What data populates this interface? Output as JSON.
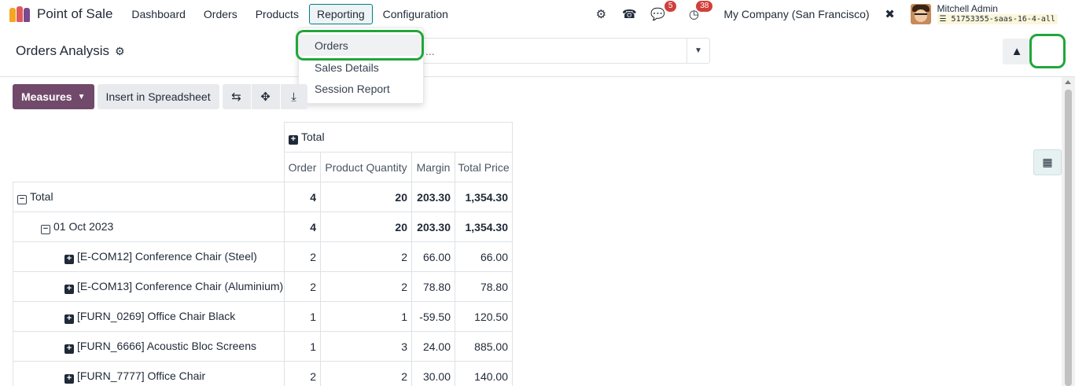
{
  "navbar": {
    "app_name": "Point of Sale",
    "menu": [
      "Dashboard",
      "Orders",
      "Products",
      "Reporting",
      "Configuration"
    ],
    "active_menu": "Reporting",
    "chat_badge": "5",
    "activity_badge": "38",
    "company": "My Company (San Francisco)",
    "user_name": "Mitchell Admin",
    "db_name": "51753355-saas-16-4-all"
  },
  "control_panel": {
    "title": "Orders Analysis",
    "search_text": "..."
  },
  "reporting_dropdown": {
    "items": [
      "Orders",
      "Sales Details",
      "Session Report"
    ]
  },
  "toolbar": {
    "measures_label": "Measures",
    "spreadsheet_label": "Insert in Spreadsheet"
  },
  "pivot": {
    "col_header": "Total",
    "measures": [
      "Order",
      "Product Quantity",
      "Margin",
      "Total Price"
    ],
    "rows": [
      {
        "label": "Total",
        "level": 0,
        "toggle": "minus",
        "values": [
          "4",
          "20",
          "203.30",
          "1,354.30"
        ]
      },
      {
        "label": "01 Oct 2023",
        "level": 1,
        "toggle": "minus",
        "values": [
          "4",
          "20",
          "203.30",
          "1,354.30"
        ]
      },
      {
        "label": "[E-COM12] Conference Chair (Steel)",
        "level": 2,
        "toggle": "plus",
        "values": [
          "2",
          "2",
          "66.00",
          "66.00"
        ]
      },
      {
        "label": "[E-COM13] Conference Chair (Aluminium)",
        "level": 2,
        "toggle": "plus",
        "values": [
          "2",
          "2",
          "78.80",
          "78.80"
        ]
      },
      {
        "label": "[FURN_0269] Office Chair Black",
        "level": 2,
        "toggle": "plus",
        "values": [
          "1",
          "1",
          "-59.50",
          "120.50"
        ]
      },
      {
        "label": "[FURN_6666] Acoustic Bloc Screens",
        "level": 2,
        "toggle": "plus",
        "values": [
          "1",
          "3",
          "24.00",
          "885.00"
        ]
      },
      {
        "label": "[FURN_7777] Office Chair",
        "level": 2,
        "toggle": "plus",
        "values": [
          "2",
          "2",
          "30.00",
          "140.00"
        ]
      }
    ]
  },
  "colors": {
    "primary": "#71496a",
    "highlight": "#22a63b",
    "badge": "#d23f3a",
    "active_border": "#017e84"
  }
}
